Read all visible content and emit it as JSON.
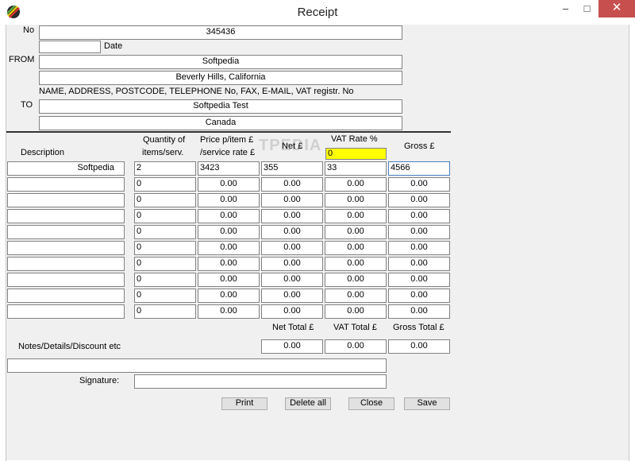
{
  "window": {
    "title": "Receipt",
    "minimize_glyph": "–",
    "maximize_glyph": "□",
    "close_glyph": "✕",
    "icon": "receipt-app-icon"
  },
  "header": {
    "no_label": "No",
    "no_value": "345436",
    "date_label": "Date",
    "date_value": "",
    "from_label": "FROM",
    "from_line1": "Softpedia",
    "from_line2": "Beverly Hills, California",
    "hint": "NAME, ADDRESS, POSTCODE, TELEPHONE No, FAX, E-MAIL, VAT registr. No",
    "to_label": "TO",
    "to_line1": "Softpedia Test",
    "to_line2": "Canada"
  },
  "columns": {
    "description": "Description",
    "quantity_1": "Quantity of",
    "quantity_2": "items/serv.",
    "price_1": "Price p/item £",
    "price_2": "/service rate £",
    "net": "Net £",
    "vat_rate": "VAT Rate %",
    "vat_rate_value": "0",
    "gross": "Gross £"
  },
  "rows": [
    {
      "description": "Softpedia",
      "quantity": "2",
      "price": "3423",
      "net": "355",
      "vat": "33",
      "gross": "4566"
    },
    {
      "description": "",
      "quantity": "0",
      "price": "0.00",
      "net": "0.00",
      "vat": "0.00",
      "gross": "0.00"
    },
    {
      "description": "",
      "quantity": "0",
      "price": "0.00",
      "net": "0.00",
      "vat": "0.00",
      "gross": "0.00"
    },
    {
      "description": "",
      "quantity": "0",
      "price": "0.00",
      "net": "0.00",
      "vat": "0.00",
      "gross": "0.00"
    },
    {
      "description": "",
      "quantity": "0",
      "price": "0.00",
      "net": "0.00",
      "vat": "0.00",
      "gross": "0.00"
    },
    {
      "description": "",
      "quantity": "0",
      "price": "0.00",
      "net": "0.00",
      "vat": "0.00",
      "gross": "0.00"
    },
    {
      "description": "",
      "quantity": "0",
      "price": "0.00",
      "net": "0.00",
      "vat": "0.00",
      "gross": "0.00"
    },
    {
      "description": "",
      "quantity": "0",
      "price": "0.00",
      "net": "0.00",
      "vat": "0.00",
      "gross": "0.00"
    },
    {
      "description": "",
      "quantity": "0",
      "price": "0.00",
      "net": "0.00",
      "vat": "0.00",
      "gross": "0.00"
    },
    {
      "description": "",
      "quantity": "0",
      "price": "0.00",
      "net": "0.00",
      "vat": "0.00",
      "gross": "0.00"
    }
  ],
  "totals": {
    "net_label": "Net Total £",
    "vat_label": "VAT Total £",
    "gross_label": "Gross Total £",
    "net_value": "0.00",
    "vat_value": "0.00",
    "gross_value": "0.00"
  },
  "notes": {
    "label": "Notes/Details/Discount etc",
    "value": ""
  },
  "signature": {
    "label": "Signature:",
    "value": ""
  },
  "buttons": {
    "print": "Print",
    "delete_all": "Delete all",
    "close": "Close",
    "save": "Save"
  },
  "watermark": "TPEDIA",
  "colors": {
    "window_bg": "#f0f0f0",
    "close_button": "#c7504f",
    "vat_rate_highlight": "#ffff00"
  }
}
